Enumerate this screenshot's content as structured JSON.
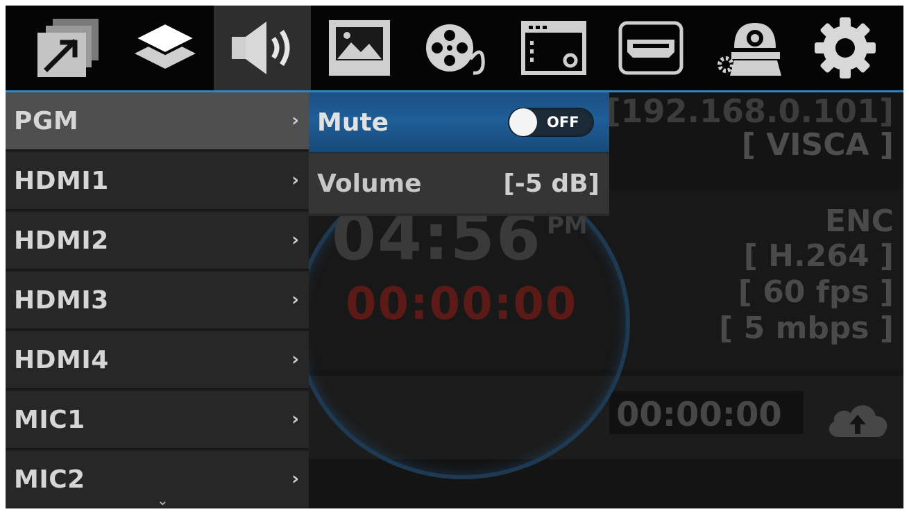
{
  "toolbar": {
    "tabs": [
      {
        "icon": "output-window-icon"
      },
      {
        "icon": "layers-icon"
      },
      {
        "icon": "speaker-icon",
        "active": true
      },
      {
        "icon": "image-icon"
      },
      {
        "icon": "film-reel-icon"
      },
      {
        "icon": "display-settings-icon"
      },
      {
        "icon": "hdmi-icon"
      },
      {
        "icon": "ptz-camera-settings-icon"
      },
      {
        "icon": "gear-icon"
      }
    ],
    "accent_color": "#2b87c8"
  },
  "menu": {
    "items": [
      {
        "label": "PGM",
        "chevron": "›",
        "selected": true
      },
      {
        "label": "HDMI1",
        "chevron": "›"
      },
      {
        "label": "HDMI2",
        "chevron": "›"
      },
      {
        "label": "HDMI3",
        "chevron": "›"
      },
      {
        "label": "HDMI4",
        "chevron": "›"
      },
      {
        "label": "MIC1",
        "chevron": "›"
      },
      {
        "label": "MIC2",
        "chevron": "›"
      }
    ],
    "more_indicator": "⌄"
  },
  "submenu": {
    "mute": {
      "label": "Mute",
      "toggle_text": "OFF",
      "state": "off"
    },
    "volume": {
      "label": "Volume",
      "value": "[-5 dB]"
    }
  },
  "background": {
    "clock_time": "04:56",
    "clock_ampm": "PM",
    "record_time": "00:00:00",
    "camera_ip": "[192.168.0.101]",
    "camera_protocol": "[ VISCA ]",
    "encoder_title": "ENC",
    "encoder_codec": "[ H.264 ]",
    "encoder_fps": "[ 60 fps ]",
    "encoder_bitrate": "[ 5 mbps ]",
    "stream_time": "00:00:00",
    "record_color": "#5c1a16"
  }
}
